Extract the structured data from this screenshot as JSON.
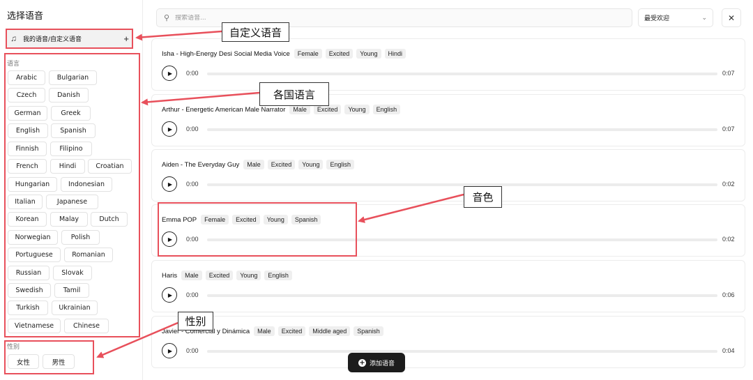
{
  "sidebar": {
    "title": "选择语音",
    "my_voice_label": "我的语音/自定义语音",
    "language_label": "语言",
    "languages": [
      "Arabic",
      "Bulgarian",
      "Czech",
      "Danish",
      "German",
      "Greek",
      "English",
      "Spanish",
      "Finnish",
      "Filipino",
      "French",
      "Hindi",
      "Croatian",
      "Hungarian",
      "Indonesian",
      "Italian",
      "Japanese",
      "Korean",
      "Malay",
      "Dutch",
      "Norwegian",
      "Polish",
      "Portuguese",
      "Romanian",
      "Russian",
      "Slovak",
      "Swedish",
      "Tamil",
      "Turkish",
      "Ukrainian",
      "Vietnamese",
      "Chinese"
    ],
    "gender_label": "性别",
    "genders": [
      "女性",
      "男性"
    ]
  },
  "search": {
    "placeholder": "搜索语音..."
  },
  "sort": {
    "selected": "最受欢迎"
  },
  "voices": [
    {
      "name": "Isha - High-Energy Desi Social Media Voice",
      "tags": [
        "Female",
        "Excited",
        "Young",
        "Hindi"
      ],
      "current": "0:00",
      "duration": "0:07"
    },
    {
      "name": "Arthur - Energetic American Male Narrator",
      "tags": [
        "Male",
        "Excited",
        "Young",
        "English"
      ],
      "current": "0:00",
      "duration": "0:07"
    },
    {
      "name": "Aiden - The Everyday Guy",
      "tags": [
        "Male",
        "Excited",
        "Young",
        "English"
      ],
      "current": "0:00",
      "duration": "0:02"
    },
    {
      "name": "Emma POP",
      "tags": [
        "Female",
        "Excited",
        "Young",
        "Spanish"
      ],
      "current": "0:00",
      "duration": "0:02"
    },
    {
      "name": "Haris",
      "tags": [
        "Male",
        "Excited",
        "Young",
        "English"
      ],
      "current": "0:00",
      "duration": "0:06"
    },
    {
      "name": "Javier - Comercial y Dinámica",
      "tags": [
        "Male",
        "Excited",
        "Middle aged",
        "Spanish"
      ],
      "current": "0:00",
      "duration": "0:04"
    }
  ],
  "add_voice_label": "添加语音",
  "annotations": {
    "custom_voice": "自定义语音",
    "languages": "各国语言",
    "timbre": "音色",
    "gender": "性别",
    "color": "#e8505b"
  }
}
